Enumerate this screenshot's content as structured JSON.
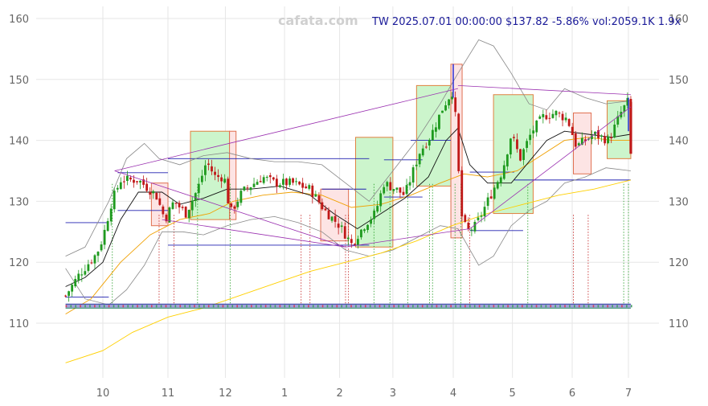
{
  "watermark": "cafata.com",
  "header": "TW 2025.07.01 00:00:00 $137.82 -5.86% vol:2059.1K 1.9x",
  "chart_data": {
    "type": "candlestick",
    "ylim": [
      100,
      162
    ],
    "y_ticks": [
      110,
      120,
      130,
      140,
      150,
      160
    ],
    "x_range": [
      -0.7,
      8.3
    ],
    "x_ticks": [
      {
        "label": "10",
        "x": 0
      },
      {
        "label": "11",
        "x": 1.1
      },
      {
        "label": "12",
        "x": 2.07
      },
      {
        "label": "1",
        "x": 3.07
      },
      {
        "label": "2",
        "x": 4.0
      },
      {
        "label": "3",
        "x": 4.9
      },
      {
        "label": "4",
        "x": 5.92
      },
      {
        "label": "5",
        "x": 6.92
      },
      {
        "label": "6",
        "x": 7.93
      },
      {
        "label": "7",
        "x": 8.88
      }
    ],
    "grid": true,
    "colors": {
      "up": "#1e9a1e",
      "down": "#c01818",
      "bb": "#888888",
      "ma_short": "#111111",
      "ma_mid": "#f0a000",
      "ma_long": "#ffd000",
      "trend": "#9a30b0",
      "level": "#2020b0",
      "zone_up": "#ccf5cc",
      "zone_down": "#fde4e4"
    },
    "price_path": [
      [
        -0.63,
        114.5
      ],
      [
        -0.4,
        118
      ],
      [
        -0.1,
        121.5
      ],
      [
        0.0,
        124
      ],
      [
        0.15,
        130
      ],
      [
        0.3,
        133.5
      ],
      [
        0.6,
        133.5
      ],
      [
        0.9,
        131
      ],
      [
        1.05,
        127
      ],
      [
        1.2,
        130
      ],
      [
        1.4,
        128
      ],
      [
        1.6,
        132
      ],
      [
        1.75,
        136.5
      ],
      [
        1.9,
        134
      ],
      [
        2.05,
        134
      ],
      [
        2.15,
        128
      ],
      [
        2.35,
        131.5
      ],
      [
        2.7,
        134
      ],
      [
        2.9,
        133
      ],
      [
        3.2,
        133
      ],
      [
        3.5,
        132
      ],
      [
        3.75,
        128.5
      ],
      [
        4.0,
        126
      ],
      [
        4.2,
        123
      ],
      [
        4.45,
        126.5
      ],
      [
        4.6,
        128
      ],
      [
        4.75,
        133
      ],
      [
        4.95,
        132
      ],
      [
        5.1,
        131
      ],
      [
        5.35,
        138
      ],
      [
        5.55,
        141
      ],
      [
        5.75,
        145.5
      ],
      [
        5.9,
        148
      ],
      [
        5.95,
        145
      ],
      [
        6.05,
        128
      ],
      [
        6.15,
        125
      ],
      [
        6.3,
        126
      ],
      [
        6.55,
        131
      ],
      [
        6.75,
        135
      ],
      [
        6.9,
        141
      ],
      [
        7.05,
        137
      ],
      [
        7.25,
        141.5
      ],
      [
        7.45,
        144
      ],
      [
        7.65,
        144.5
      ],
      [
        7.85,
        143.5
      ],
      [
        8.0,
        139
      ],
      [
        8.3,
        141
      ],
      [
        8.55,
        140
      ],
      [
        8.75,
        144.5
      ],
      [
        8.88,
        146.5
      ],
      [
        8.92,
        137.8
      ]
    ],
    "ma_short": [
      [
        -0.63,
        116
      ],
      [
        -0.3,
        117.5
      ],
      [
        0.0,
        120
      ],
      [
        0.3,
        127
      ],
      [
        0.6,
        131.5
      ],
      [
        1.0,
        131.5
      ],
      [
        1.3,
        129.5
      ],
      [
        1.7,
        130.5
      ],
      [
        2.1,
        132
      ],
      [
        2.5,
        132
      ],
      [
        3.0,
        132.5
      ],
      [
        3.5,
        131
      ],
      [
        3.9,
        128
      ],
      [
        4.3,
        125.5
      ],
      [
        4.7,
        128
      ],
      [
        5.1,
        130.5
      ],
      [
        5.5,
        134
      ],
      [
        5.8,
        140
      ],
      [
        6.0,
        142
      ],
      [
        6.2,
        136
      ],
      [
        6.5,
        133
      ],
      [
        6.9,
        133
      ],
      [
        7.2,
        136.5
      ],
      [
        7.5,
        140
      ],
      [
        7.8,
        141.5
      ],
      [
        8.2,
        141
      ],
      [
        8.6,
        140.5
      ],
      [
        8.92,
        141
      ]
    ],
    "ma_mid": [
      [
        -0.63,
        111.5
      ],
      [
        -0.2,
        114
      ],
      [
        0.3,
        120
      ],
      [
        0.8,
        124.5
      ],
      [
        1.3,
        127
      ],
      [
        1.8,
        128
      ],
      [
        2.2,
        130
      ],
      [
        2.7,
        131
      ],
      [
        3.2,
        131.5
      ],
      [
        3.7,
        131
      ],
      [
        4.2,
        129
      ],
      [
        4.7,
        129.5
      ],
      [
        5.2,
        131
      ],
      [
        5.7,
        133
      ],
      [
        6.1,
        134.5
      ],
      [
        6.5,
        134
      ],
      [
        7.0,
        135
      ],
      [
        7.4,
        137.5
      ],
      [
        7.8,
        140
      ],
      [
        8.2,
        140.5
      ],
      [
        8.6,
        140
      ],
      [
        8.92,
        140
      ]
    ],
    "ma_long": [
      [
        -0.63,
        103.5
      ],
      [
        0.0,
        105.5
      ],
      [
        0.5,
        108.5
      ],
      [
        1.1,
        111
      ],
      [
        1.7,
        112.5
      ],
      [
        2.3,
        114.5
      ],
      [
        2.9,
        116.5
      ],
      [
        3.5,
        118.5
      ],
      [
        4.1,
        120
      ],
      [
        4.7,
        121.5
      ],
      [
        5.3,
        123.5
      ],
      [
        5.9,
        126
      ],
      [
        6.5,
        128
      ],
      [
        7.1,
        129.5
      ],
      [
        7.7,
        131
      ],
      [
        8.3,
        132
      ],
      [
        8.92,
        133.5
      ]
    ],
    "bb_upper": [
      [
        -0.63,
        121
      ],
      [
        -0.3,
        122.5
      ],
      [
        0.1,
        130
      ],
      [
        0.4,
        137
      ],
      [
        0.7,
        139.5
      ],
      [
        0.95,
        137
      ],
      [
        1.3,
        136
      ],
      [
        1.7,
        137.5
      ],
      [
        2.1,
        138
      ],
      [
        2.5,
        137
      ],
      [
        2.9,
        136.5
      ],
      [
        3.3,
        136.5
      ],
      [
        3.7,
        136
      ],
      [
        4.1,
        133
      ],
      [
        4.5,
        130
      ],
      [
        4.9,
        135
      ],
      [
        5.3,
        140
      ],
      [
        5.7,
        146
      ],
      [
        6.0,
        151
      ],
      [
        6.35,
        156.5
      ],
      [
        6.6,
        155.5
      ],
      [
        6.9,
        151
      ],
      [
        7.2,
        146
      ],
      [
        7.5,
        145
      ],
      [
        7.8,
        148.5
      ],
      [
        8.15,
        147
      ],
      [
        8.5,
        146
      ],
      [
        8.92,
        146.5
      ]
    ],
    "bb_lower": [
      [
        -0.63,
        119
      ],
      [
        -0.3,
        114
      ],
      [
        0.1,
        113
      ],
      [
        0.4,
        115.5
      ],
      [
        0.7,
        119.5
      ],
      [
        1.0,
        125
      ],
      [
        1.35,
        125
      ],
      [
        1.7,
        124.5
      ],
      [
        2.1,
        126
      ],
      [
        2.5,
        127
      ],
      [
        2.9,
        127.5
      ],
      [
        3.3,
        126.5
      ],
      [
        3.7,
        125
      ],
      [
        4.1,
        122
      ],
      [
        4.5,
        121
      ],
      [
        4.9,
        122
      ],
      [
        5.3,
        124
      ],
      [
        5.7,
        126
      ],
      [
        6.0,
        125.5
      ],
      [
        6.35,
        119.5
      ],
      [
        6.6,
        121
      ],
      [
        6.9,
        126
      ],
      [
        7.2,
        128.5
      ],
      [
        7.5,
        130
      ],
      [
        7.8,
        133
      ],
      [
        8.15,
        134
      ],
      [
        8.5,
        135.5
      ],
      [
        8.92,
        135
      ]
    ],
    "zones": [
      {
        "kind": "down",
        "x0": 0.82,
        "x1": 1.1,
        "y0": 126,
        "y1": 133
      },
      {
        "kind": "up",
        "x0": 1.48,
        "x1": 2.14,
        "y0": 127,
        "y1": 141.5
      },
      {
        "kind": "down",
        "x0": 2.14,
        "x1": 2.25,
        "y0": 127,
        "y1": 141.5
      },
      {
        "kind": "down",
        "x0": 3.68,
        "x1": 4.15,
        "y0": 123.5,
        "y1": 132
      },
      {
        "kind": "up",
        "x0": 4.27,
        "x1": 4.9,
        "y0": 122.5,
        "y1": 140.5
      },
      {
        "kind": "up",
        "x0": 5.3,
        "x1": 5.88,
        "y0": 132.5,
        "y1": 149
      },
      {
        "kind": "down",
        "x0": 5.88,
        "x1": 6.07,
        "y0": 124,
        "y1": 152.5
      },
      {
        "kind": "up",
        "x0": 6.6,
        "x1": 7.27,
        "y0": 128,
        "y1": 147.5
      },
      {
        "kind": "down",
        "x0": 7.95,
        "x1": 8.25,
        "y0": 134.5,
        "y1": 144.5
      },
      {
        "kind": "up",
        "x0": 8.52,
        "x1": 8.92,
        "y0": 137,
        "y1": 146.5
      }
    ],
    "trend_lines": [
      {
        "x0": 0.2,
        "y0": 135,
        "x1": 4.1,
        "y1": 122.5
      },
      {
        "x0": 0.2,
        "y0": 135,
        "x1": 6.0,
        "y1": 148.5
      },
      {
        "x0": 4.1,
        "y0": 122.5,
        "x1": 6.2,
        "y1": 125.5
      },
      {
        "x0": 6.0,
        "y0": 149,
        "x1": 8.92,
        "y1": 147.5
      },
      {
        "x0": 6.2,
        "y0": 125.5,
        "x1": 8.92,
        "y1": 145.5
      },
      {
        "x0": 1.0,
        "y0": 127,
        "x1": 4.1,
        "y1": 122.5
      }
    ],
    "level_lines": [
      {
        "x0": -0.63,
        "x1": 0.1,
        "y": 126.5
      },
      {
        "x0": -0.63,
        "x1": 0.1,
        "y": 114.3
      },
      {
        "x0": 0.25,
        "x1": 1.1,
        "y": 134.7
      },
      {
        "x0": 0.25,
        "x1": 1.1,
        "y": 128.5
      },
      {
        "x0": 1.1,
        "x1": 4.5,
        "y": 137
      },
      {
        "x0": 1.1,
        "x1": 4.5,
        "y": 122.8
      },
      {
        "x0": 3.7,
        "x1": 4.45,
        "y": 132
      },
      {
        "x0": 4.75,
        "x1": 5.4,
        "y": 136.8
      },
      {
        "x0": 4.75,
        "x1": 5.4,
        "y": 130.7
      },
      {
        "x0": 5.2,
        "x1": 5.88,
        "y": 140
      },
      {
        "x0": 6.2,
        "x1": 7.1,
        "y": 125.2
      },
      {
        "x0": 6.2,
        "x1": 6.95,
        "y": 134.8
      },
      {
        "x0": 6.95,
        "x1": 8.92,
        "y": 133.5
      }
    ],
    "signal_lines": [
      {
        "x": 0.16,
        "kind": "up"
      },
      {
        "x": 0.95,
        "kind": "down"
      },
      {
        "x": 1.2,
        "kind": "down"
      },
      {
        "x": 1.6,
        "kind": "up"
      },
      {
        "x": 2.15,
        "kind": "up"
      },
      {
        "x": 3.35,
        "kind": "down"
      },
      {
        "x": 3.5,
        "kind": "down"
      },
      {
        "x": 4.1,
        "kind": "down"
      },
      {
        "x": 4.15,
        "kind": "down"
      },
      {
        "x": 4.58,
        "kind": "up"
      },
      {
        "x": 4.85,
        "kind": "up"
      },
      {
        "x": 5.15,
        "kind": "up"
      },
      {
        "x": 5.52,
        "kind": "up"
      },
      {
        "x": 5.57,
        "kind": "up"
      },
      {
        "x": 5.95,
        "kind": "up"
      },
      {
        "x": 6.05,
        "kind": "up"
      },
      {
        "x": 6.2,
        "kind": "down"
      },
      {
        "x": 7.18,
        "kind": "up"
      },
      {
        "x": 7.95,
        "kind": "down"
      },
      {
        "x": 8.2,
        "kind": "down"
      },
      {
        "x": 8.8,
        "kind": "up"
      },
      {
        "x": 8.88,
        "kind": "up"
      }
    ],
    "volume_strip_y": 112.8
  }
}
